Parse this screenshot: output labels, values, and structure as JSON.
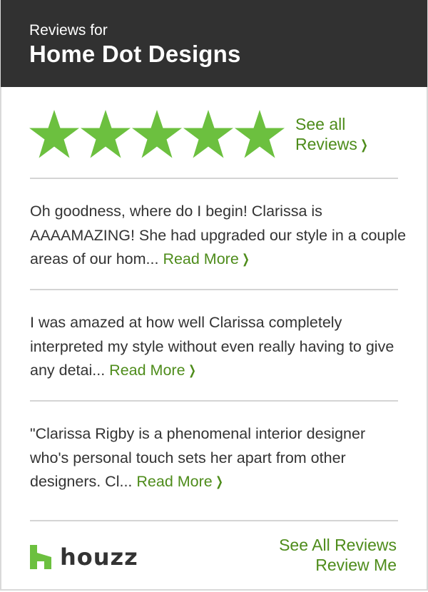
{
  "header": {
    "subtitle": "Reviews for",
    "title": "Home Dot Designs"
  },
  "rating": {
    "stars": 5,
    "max_stars": 5,
    "star_color": "#6cc03f"
  },
  "see_all_link": {
    "line1": "See all",
    "line2": "Reviews"
  },
  "reviews": [
    {
      "text": "Oh goodness, where do I begin! Clarissa is AAAAMAZING! She had upgraded our style in a couple areas of our hom...",
      "read_more": "Read More"
    },
    {
      "text": "I was amazed at how well Clarissa completely interpreted my style without even really having to give any detai...",
      "read_more": "Read More"
    },
    {
      "text": "\"Clarissa Rigby is a phenomenal interior designer who's personal touch sets her apart from other designers. Cl...",
      "read_more": "Read More"
    }
  ],
  "footer": {
    "logo_text": "houzz",
    "see_all_reviews": "See All Reviews",
    "review_me": "Review Me"
  },
  "colors": {
    "header_bg": "#313131",
    "link": "#4e8c1b",
    "houzz_green": "#6cc03f"
  },
  "icons": [
    "star-icon",
    "chevron-right-icon",
    "houzz-logo-icon"
  ]
}
